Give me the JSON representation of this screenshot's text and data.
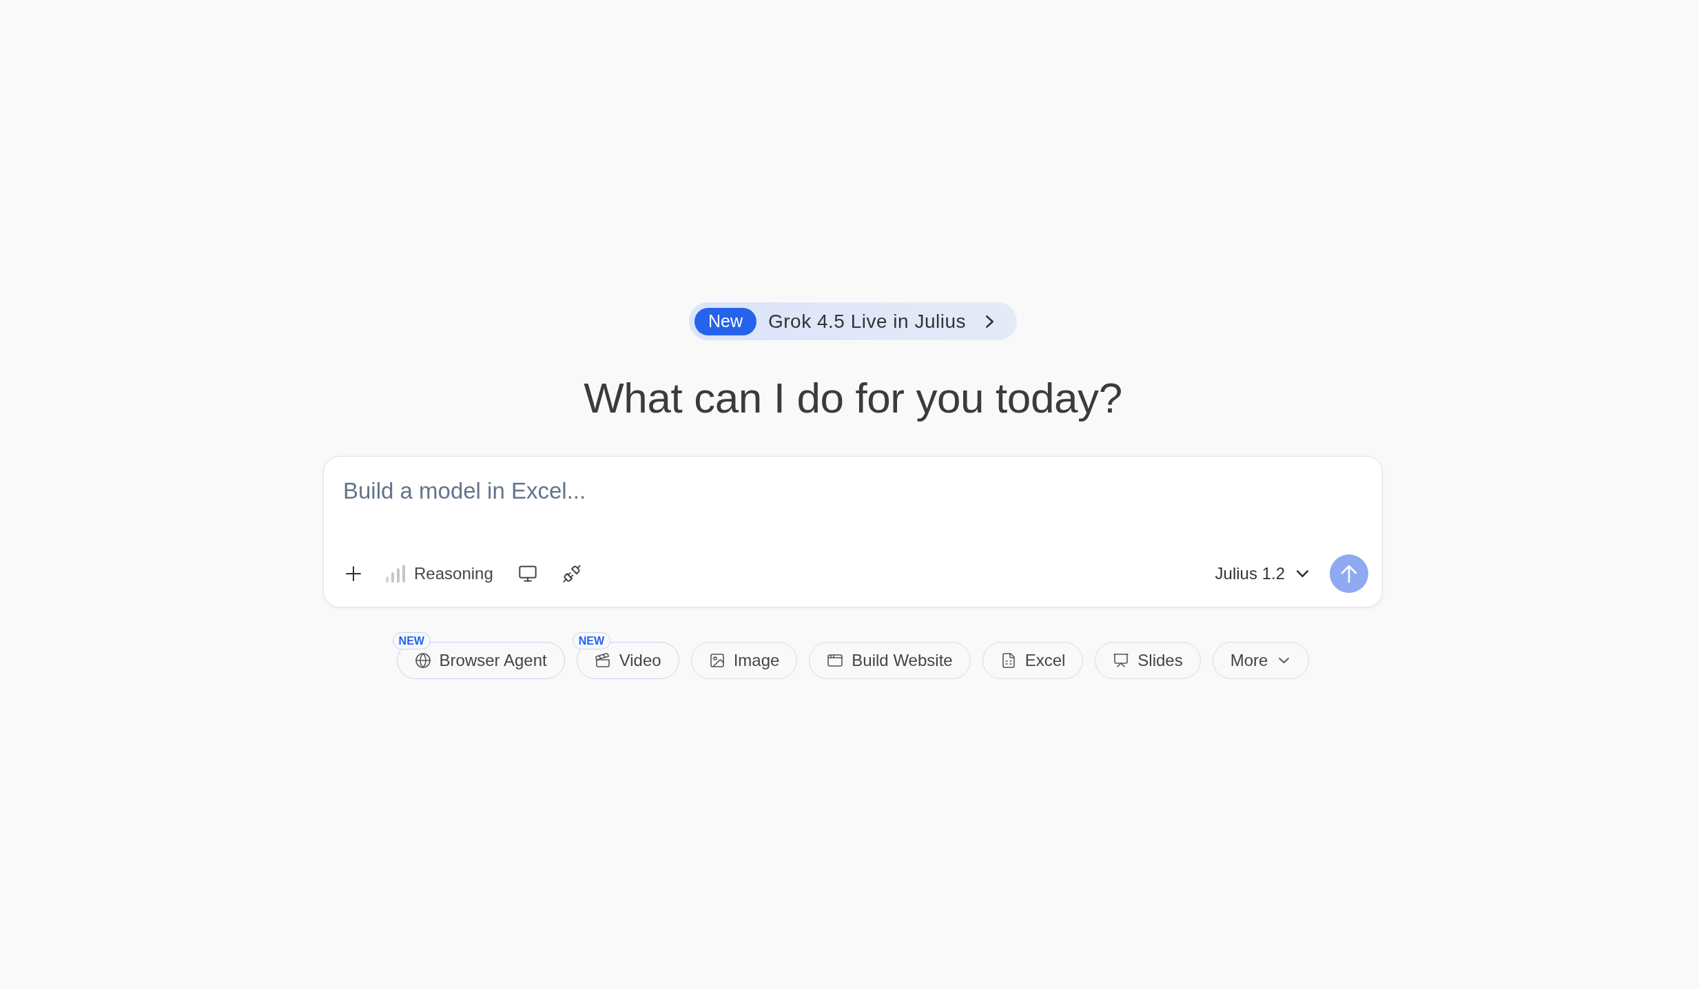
{
  "announcement": {
    "badge": "New",
    "text": "Grok 4.5 Live in Julius"
  },
  "heading": "What can I do for you today?",
  "composer": {
    "placeholder": "Build a model in Excel...",
    "tools": [
      {
        "kind": "add"
      },
      {
        "kind": "reasoning",
        "label": "Reasoning"
      },
      {
        "kind": "screen"
      },
      {
        "kind": "connector"
      }
    ],
    "model": "Julius 1.2",
    "send_button": {
      "disabled": true
    }
  },
  "shortcuts": [
    {
      "kind": "browser",
      "label": "Browser Agent",
      "badge": "NEW"
    },
    {
      "kind": "video",
      "label": "Video",
      "badge": "NEW"
    },
    {
      "kind": "image",
      "label": "Image"
    },
    {
      "kind": "website",
      "label": "Build Website"
    },
    {
      "kind": "excel",
      "label": "Excel"
    },
    {
      "kind": "slides",
      "label": "Slides"
    },
    {
      "kind": "more",
      "label": "More"
    }
  ]
}
